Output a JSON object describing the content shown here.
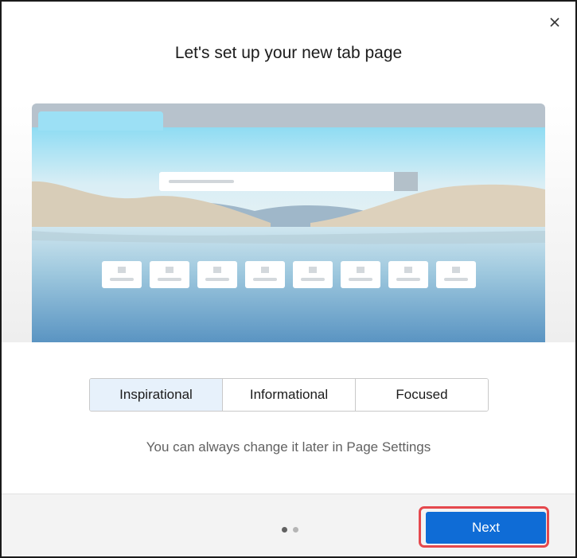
{
  "dialog": {
    "title": "Let's set up your new tab page",
    "close_icon": "close-icon"
  },
  "layout_options": [
    {
      "label": "Inspirational",
      "selected": true
    },
    {
      "label": "Informational",
      "selected": false
    },
    {
      "label": "Focused",
      "selected": false
    }
  ],
  "hint": "You can always change it later in Page Settings",
  "pager": {
    "current": 1,
    "total": 2
  },
  "footer": {
    "next_label": "Next"
  },
  "colors": {
    "accent": "#0f6cd6",
    "highlight": "#e5484d",
    "selected_option": "#e7f1fb"
  }
}
